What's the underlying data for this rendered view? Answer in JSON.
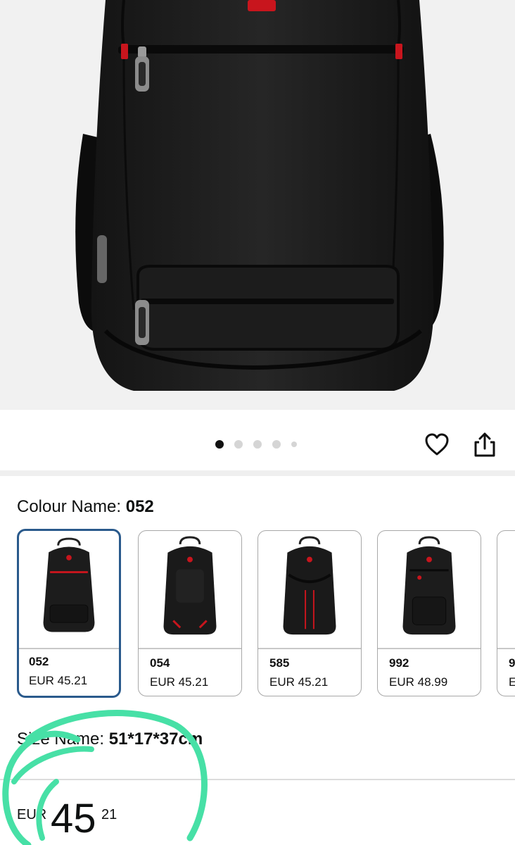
{
  "gallery": {
    "dots": [
      {
        "state": "active"
      },
      {
        "state": "inactive"
      },
      {
        "state": "inactive"
      },
      {
        "state": "inactive"
      },
      {
        "state": "small"
      }
    ],
    "wishlist_icon": "heart-icon",
    "share_icon": "share-icon"
  },
  "colour": {
    "label": "Colour Name:",
    "selected_value": "052",
    "options": [
      {
        "code": "052",
        "price": "EUR 45.21",
        "selected": true
      },
      {
        "code": "054",
        "price": "EUR 45.21",
        "selected": false
      },
      {
        "code": "585",
        "price": "EUR 45.21",
        "selected": false
      },
      {
        "code": "992",
        "price": "EUR 48.99",
        "selected": false
      },
      {
        "code": "9",
        "price": "E",
        "selected": false
      }
    ]
  },
  "size": {
    "label": "Size Name:",
    "value": "51*17*37cm"
  },
  "price": {
    "currency": "EUR",
    "whole": "45",
    "fraction": "21"
  },
  "colors": {
    "accent_selected_border": "#2a5a8c",
    "annotation": "#47e0a6",
    "backpack_red": "#c8151d"
  }
}
